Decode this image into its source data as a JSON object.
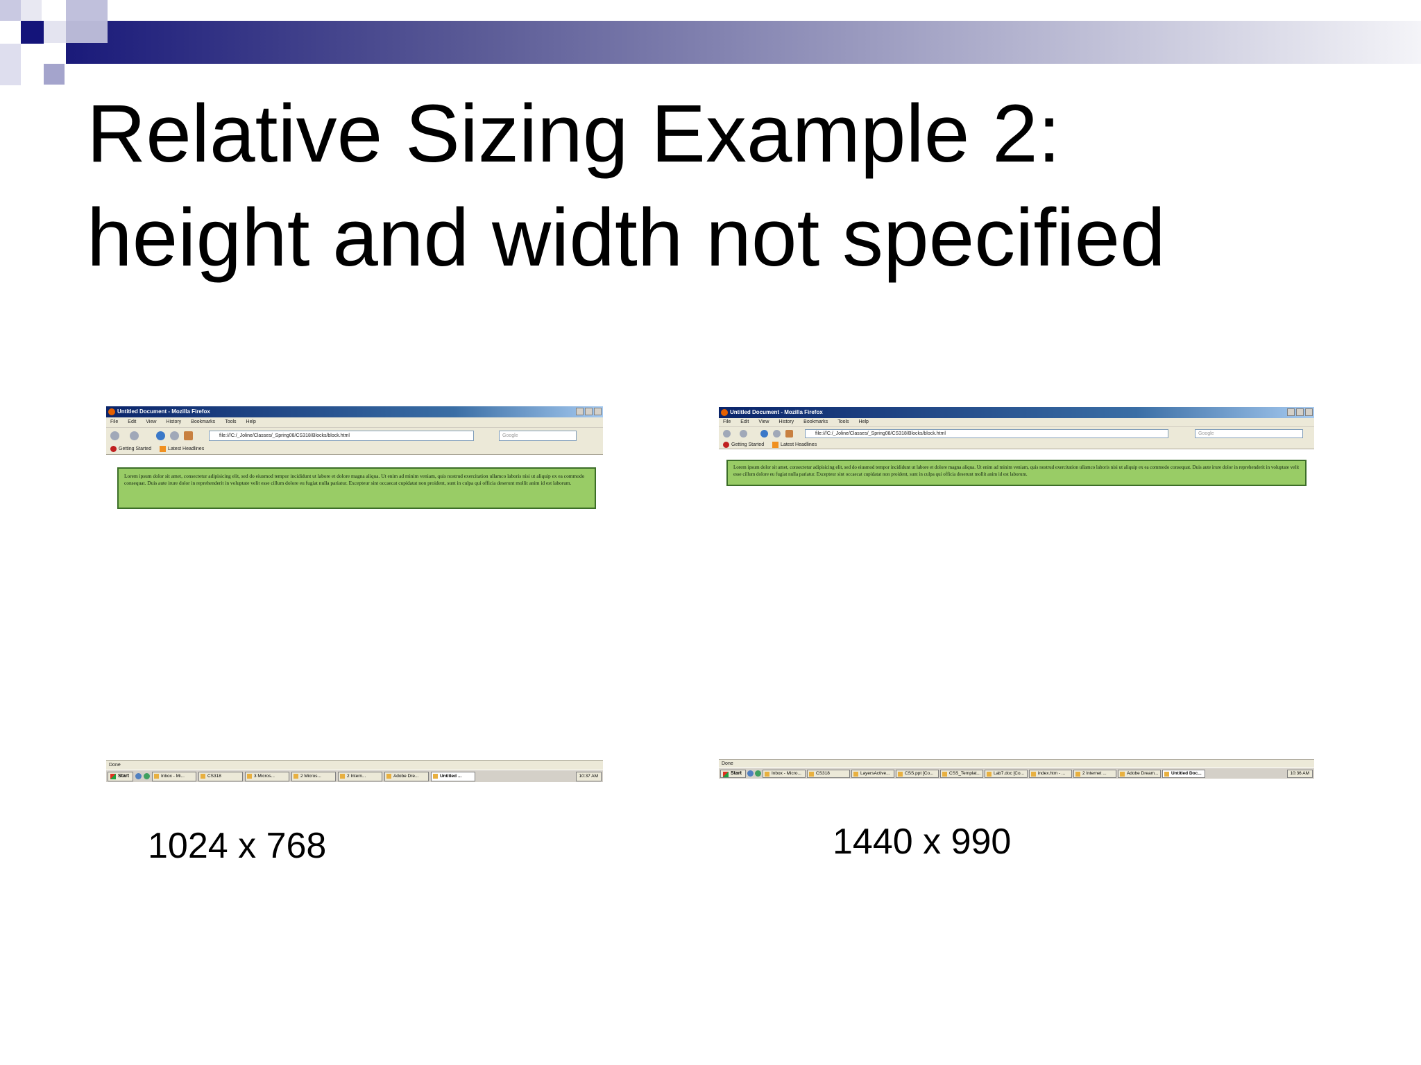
{
  "slide": {
    "title_line1": "Relative Sizing Example 2:",
    "title_line2": "height and width not specified"
  },
  "browser": {
    "window_title": "Untitled Document - Mozilla Firefox",
    "menu": [
      "File",
      "Edit",
      "View",
      "History",
      "Bookmarks",
      "Tools",
      "Help"
    ],
    "url": "file:///C:/_Joline/Classes/_Spring08/CS318/Blocks/block.html",
    "search_placeholder": "Google",
    "bookmark_1": "Getting Started",
    "bookmark_2": "Latest Headlines",
    "lorem": "Lorem ipsum dolor sit amet, consectetur adipisicing elit, sed do eiusmod tempor incididunt ut labore et dolore magna aliqua. Ut enim ad minim veniam, quis nostrud exercitation ullamco laboris nisi ut aliquip ex ea commodo consequat. Duis aute irure dolor in reprehenderit in voluptate velit esse cillum dolore eu fugiat nulla pariatur. Excepteur sint occaecat cupidatat non proident, sunt in culpa qui officia deserunt mollit anim id est laborum.",
    "status": "Done",
    "start_label": "Start"
  },
  "shot_a": {
    "taskbar": [
      "Inbox - Mi...",
      "CS318",
      "3 Micros...",
      "2 Micros...",
      "2 Intern...",
      "Adobe Dre...",
      "Untitled ..."
    ],
    "clock": "10:37 AM",
    "caption": "1024 x 768"
  },
  "shot_b": {
    "taskbar": [
      "Inbox - Micro...",
      "CS318",
      "LayersActive...",
      "CSS.ppt [Co...",
      "CSS_Templat...",
      "Lab7.doc [Co...",
      "index.htm - ...",
      "2 Internet ...",
      "Adobe Dream...",
      "Untitled Doc..."
    ],
    "clock": "10:36 AM",
    "caption": "1440 x 990"
  }
}
